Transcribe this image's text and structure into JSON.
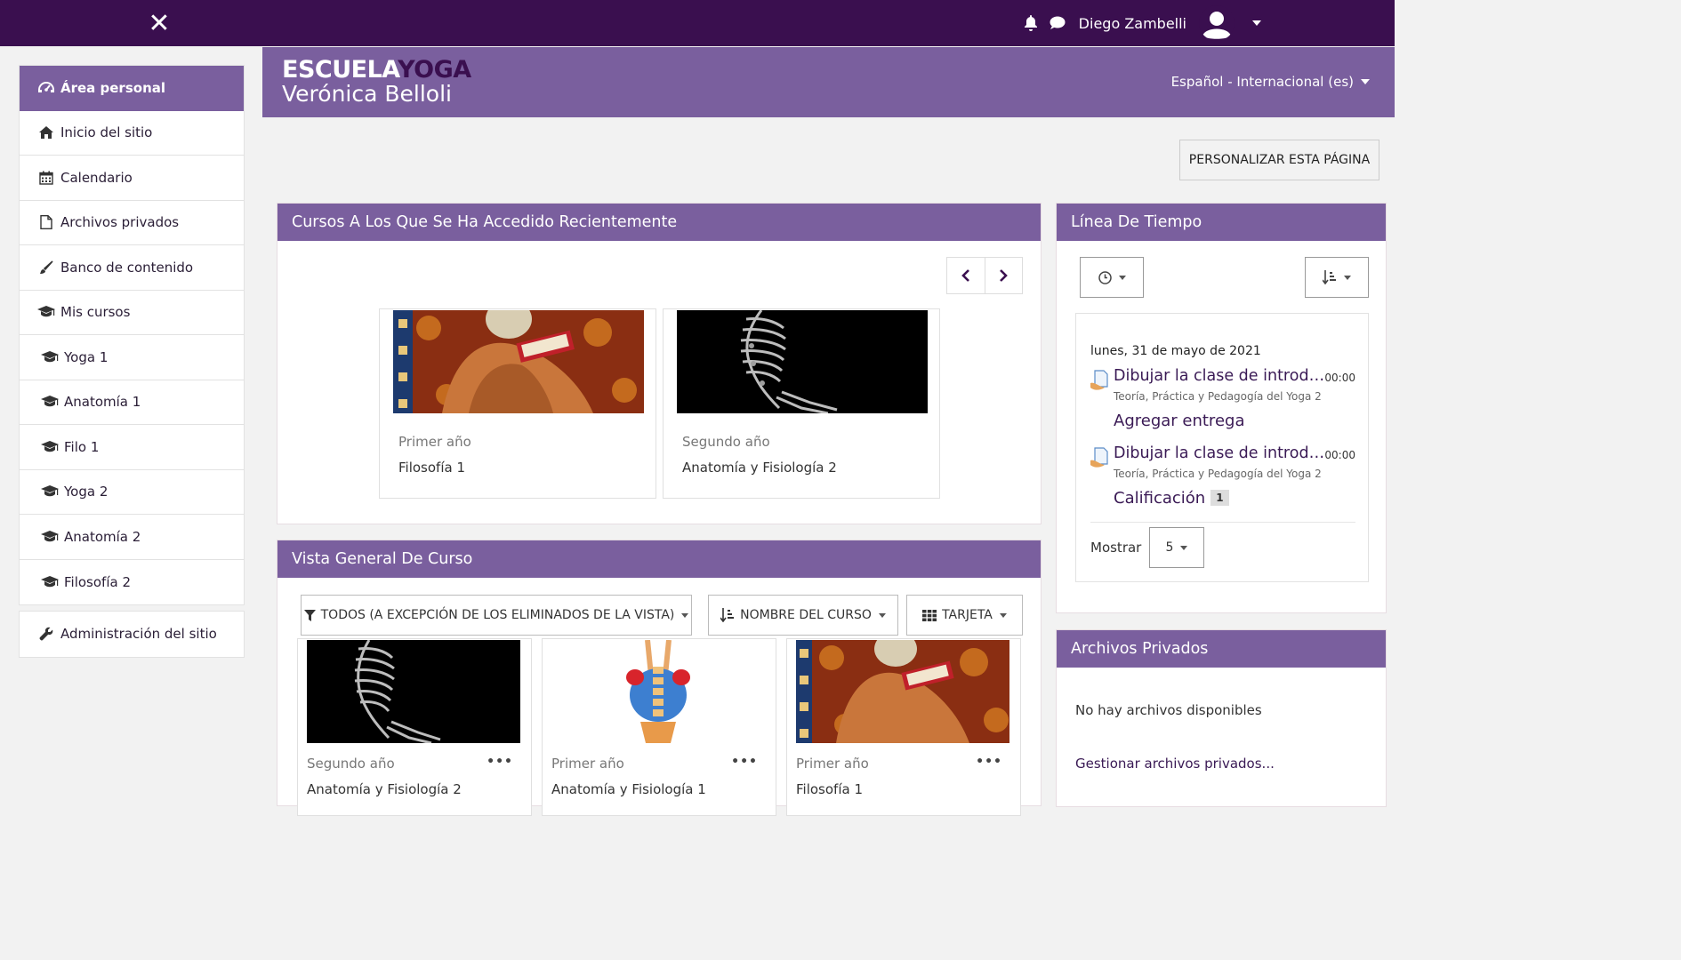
{
  "navbar": {
    "close_icon": "close-icon",
    "user_name": "Diego Zambelli",
    "icons": [
      "bell-icon",
      "chat-icon",
      "avatar",
      "caret-down-icon"
    ]
  },
  "sidebar": {
    "items": [
      {
        "label": "Área personal",
        "icon": "dashboard-icon",
        "active": true
      },
      {
        "label": "Inicio del sitio",
        "icon": "home-icon"
      },
      {
        "label": "Calendario",
        "icon": "calendar-icon"
      },
      {
        "label": "Archivos privados",
        "icon": "file-icon"
      },
      {
        "label": "Banco de contenido",
        "icon": "brush-icon"
      },
      {
        "label": "Mis cursos",
        "icon": "graduation-cap-icon"
      },
      {
        "label": "Yoga 1",
        "icon": "graduation-cap-icon"
      },
      {
        "label": "Anatomía 1",
        "icon": "graduation-cap-icon"
      },
      {
        "label": "Filo 1",
        "icon": "graduation-cap-icon"
      },
      {
        "label": "Yoga 2",
        "icon": "graduation-cap-icon"
      },
      {
        "label": "Anatomía 2",
        "icon": "graduation-cap-icon"
      },
      {
        "label": "Filosofía 2",
        "icon": "graduation-cap-icon"
      }
    ],
    "admin": {
      "label": "Administración del sitio",
      "icon": "wrench-icon"
    }
  },
  "banner": {
    "logo_line1_a": "ESCUELA",
    "logo_line1_b": "YOGA",
    "logo_line2": "Verónica Belloli",
    "language": "Español - Internacional (es)"
  },
  "customize_label": "PERSONALIZAR ESTA PÁGINA",
  "recent": {
    "title": "Cursos A Los Que Se Ha Accedido Recientemente",
    "cards": [
      {
        "category": "Primer año",
        "name": "Filosofía 1",
        "image": "meditation-image"
      },
      {
        "category": "Segundo año",
        "name": "Anatomía y Fisiología 2",
        "image": "skeleton-image"
      }
    ]
  },
  "overview": {
    "title": "Vista General De Curso",
    "filter_label": "TODOS (A EXCEPCIÓN DE LOS ELIMINADOS DE LA VISTA)",
    "sort_label": "NOMBRE DEL CURSO",
    "view_label": "TARJETA",
    "cards": [
      {
        "category": "Segundo año",
        "name": "Anatomía y Fisiología 2",
        "image": "skeleton-image"
      },
      {
        "category": "Primer año",
        "name": "Anatomía y Fisiología 1",
        "image": "spine-image"
      },
      {
        "category": "Primer año",
        "name": "Filosofía 1",
        "image": "meditation-image"
      }
    ],
    "menu_glyph": "•••"
  },
  "timeline": {
    "title": "Línea De Tiempo",
    "date": "lunes, 31 de mayo de 2021",
    "events": [
      {
        "title": "Dibujar la clase de introducción",
        "time": "00:00",
        "course": "Teoría, Práctica y Pedagogía del Yoga 2",
        "action": "Agregar entrega"
      },
      {
        "title": "Dibujar la clase de introducción",
        "time": "00:00",
        "course": "Teoría, Práctica y Pedagogía del Yoga 2",
        "action": "Calificación",
        "badge": "1"
      }
    ],
    "show_label": "Mostrar",
    "show_value": "5"
  },
  "private_files": {
    "title": "Archivos Privados",
    "empty": "No hay archivos disponibles",
    "manage": "Gestionar archivos privados..."
  },
  "colors": {
    "navbar": "#3a0f4f",
    "accent": "#7a5f9e",
    "link": "#3a1a55"
  }
}
